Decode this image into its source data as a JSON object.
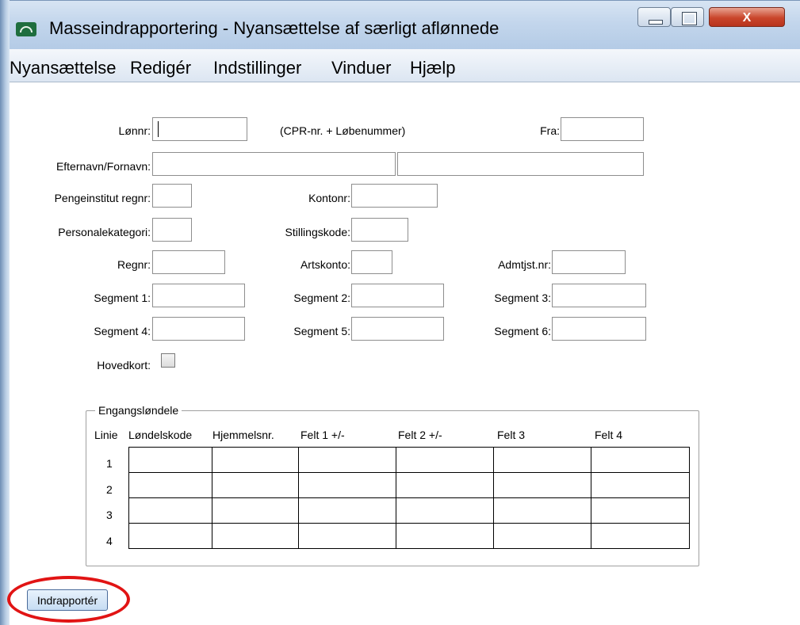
{
  "window": {
    "title": "Masseindrapportering - Nyansættelse af særligt aflønnede",
    "app_icon": "gauge-icon",
    "controls": {
      "minimize": "minimize-icon",
      "maximize": "maximize-icon",
      "close_label": "X"
    }
  },
  "menu": [
    "Nyansættelse",
    "Redigér",
    "Indstillinger",
    "Vinduer",
    "Hjælp"
  ],
  "form": {
    "lonnr_label": "Lønnr:",
    "lonnr_hint": "(CPR-nr. + Løbenummer)",
    "fra_label": "Fra:",
    "navn_label": "Efternavn/Fornavn:",
    "regnr_bank_label": "Pengeinstitut regnr:",
    "kontonr_label": "Kontonr:",
    "personalekategori_label": "Personalekategori:",
    "stillingskode_label": "Stillingskode:",
    "regnr_label": "Regnr:",
    "artskonto_label": "Artskonto:",
    "admtjst_label": "Admtjst.nr:",
    "segment1_label": "Segment 1:",
    "segment2_label": "Segment 2:",
    "segment3_label": "Segment 3:",
    "segment4_label": "Segment 4:",
    "segment5_label": "Segment 5:",
    "segment6_label": "Segment 6:",
    "hovedkort_label": "Hovedkort:"
  },
  "engang": {
    "group_label": "Engangsløndele",
    "columns": [
      "Linie",
      "Løndelskode",
      "Hjemmelsnr.",
      "Felt 1 +/-",
      "Felt 2 +/-",
      "Felt 3",
      "Felt 4"
    ],
    "rows": [
      "1",
      "2",
      "3",
      "4"
    ]
  },
  "submit_label": "Indrapportér",
  "accent_colors": {
    "highlight": "#e11414",
    "titlebar": "#c3d6ec",
    "close": "#c9452b"
  }
}
